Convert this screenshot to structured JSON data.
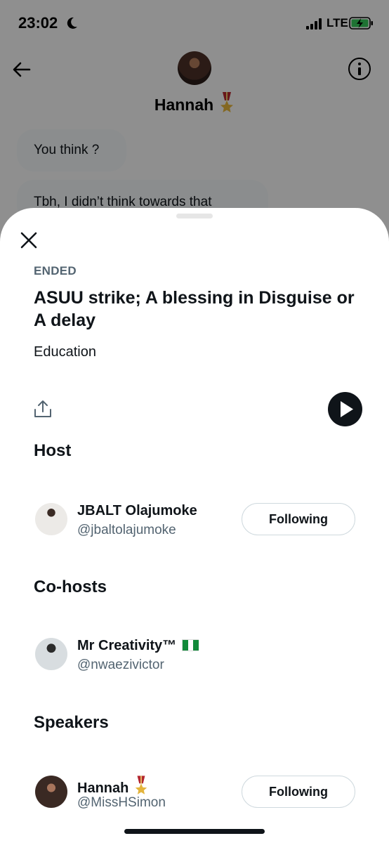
{
  "status_bar": {
    "time": "23:02",
    "network": "LTE"
  },
  "conversation": {
    "name": "Hannah",
    "messages": [
      "You think ?",
      "Tbh, I didn’t think towards that"
    ]
  },
  "space": {
    "state": "ENDED",
    "title": "ASUU strike; A blessing in Disguise or A delay",
    "topic": "Education",
    "sections": {
      "host_title": "Host",
      "cohosts_title": "Co-hosts",
      "speakers_title": "Speakers"
    },
    "host": {
      "name": "JBALT Olajumoke",
      "handle": "@jbaltolajumoke",
      "follow_label": "Following"
    },
    "cohost": {
      "name": "Mr Creativity™",
      "handle": "@nwaezivictor"
    },
    "speaker": {
      "name": "Hannah",
      "handle": "@MissHSimon",
      "follow_label": "Following"
    }
  },
  "colors": {
    "accent_dark": "#0f1419",
    "secondary_text": "#536471",
    "button_border": "#cfd9de"
  },
  "icons": [
    "back-arrow-icon",
    "info-icon",
    "close-icon",
    "share-icon",
    "play-icon",
    "medal-icon",
    "nigeria-flag-icon",
    "moon-icon",
    "signal-icon",
    "battery-charging-icon"
  ]
}
